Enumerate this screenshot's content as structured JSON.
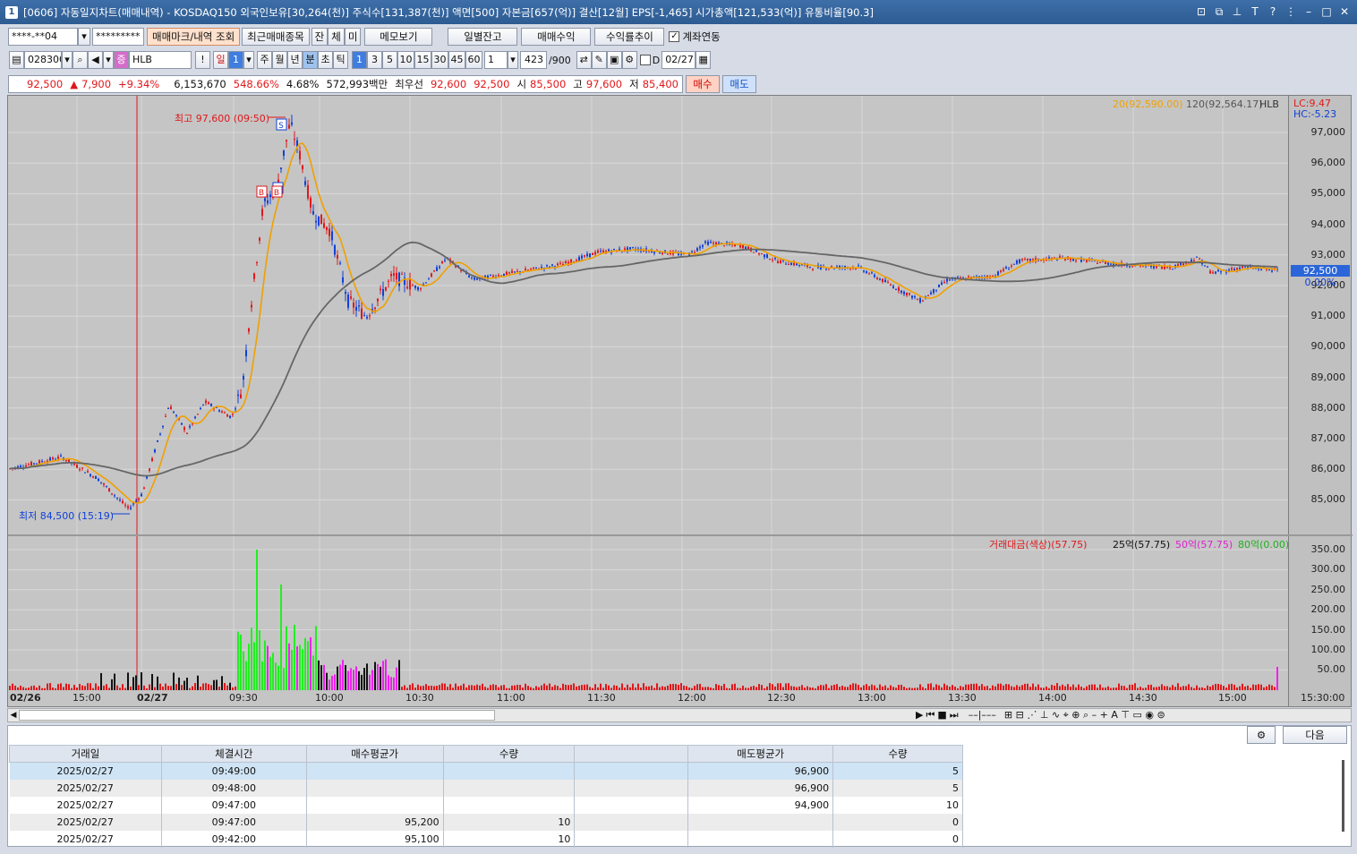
{
  "window": {
    "number": "1",
    "title": "[0606] 자동일지차트(매매내역) - KOSDAQ150 외국인보유[30,264(천)] 주식수[131,387(천)] 액면[500] 자본금[657(억)] 결산[12월] EPS[-1,465] 시가총액[121,533(억)] 유통비율[90.3]"
  },
  "toolbar1": {
    "account": "****-**04",
    "password": "*********",
    "btn_trade_marks": "매매마크/내역 조회",
    "btn_recent_items": "최근매매종목",
    "btn_jan": "잔",
    "btn_che": "체",
    "btn_mi": "미",
    "btn_memo": "메모보기",
    "btn_daily_balance": "일별잔고",
    "btn_trade_profit": "매매수익",
    "btn_profit_trend": "수익률추이",
    "account_link_label": "계좌연동"
  },
  "toolbar2": {
    "code": "028300",
    "stock_badge": "증",
    "stock_name": "HLB",
    "period_day": "일",
    "period_value": "1",
    "period_week": "주",
    "period_month": "월",
    "period_year": "년",
    "period_minute": "분",
    "period_sec": "초",
    "period_tick": "틱",
    "intervals": [
      "1",
      "3",
      "5",
      "10",
      "15",
      "30",
      "45",
      "60"
    ],
    "custom_interval": "1",
    "count": "423",
    "count_max": "/900",
    "d_label": "D",
    "date": "02/27"
  },
  "infobar": {
    "price": "92,500",
    "change_arrow": "▲",
    "change": "7,900",
    "change_pct": "+9.34%",
    "volume": "6,153,670",
    "vol_ratio": "548.66%",
    "turnover": "4.68%",
    "amount": "572,993백만",
    "best_bid_label": "최우선",
    "best_ask": "92,600",
    "best_bid": "92,500",
    "open_label": "시",
    "open": "85,500",
    "high_label": "고",
    "high": "97,600",
    "low_label": "저",
    "low": "85,400",
    "buy_btn": "매수",
    "sell_btn": "매도"
  },
  "chart_data": {
    "type": "line",
    "legend": {
      "ma20": "20(92,590.00)",
      "ma120": "120(92,564.17)",
      "stock": "HLB",
      "lc": "LC:9.47",
      "hc": "HC:-5.23"
    },
    "price_ticks": [
      "97,000",
      "96,000",
      "95,000",
      "94,000",
      "93,000",
      "92,000",
      "91,000",
      "90,000",
      "89,000",
      "88,000",
      "87,000",
      "86,000",
      "85,000"
    ],
    "current_price_tag": "92,500",
    "current_pct_tag": "0.00%",
    "high_annotation": "최고 97,600 (09:50)",
    "low_annotation": "최저 84,500 (15:19)",
    "marks": [
      "S",
      "B",
      "S",
      "B"
    ],
    "volume_legend": {
      "amount": "거래대금(색상)(57.75)",
      "ma25": "25억(57.75)",
      "ma50": "50억(57.75)",
      "ma80": "80억(0.00)"
    },
    "volume_ticks": [
      "350.00",
      "300.00",
      "250.00",
      "200.00",
      "150.00",
      "100.00",
      "50.00"
    ],
    "time_labels": [
      "02/26",
      "15:00",
      "02/27",
      "09:30",
      "10:00",
      "10:30",
      "11:00",
      "11:30",
      "12:00",
      "12:30",
      "13:00",
      "13:30",
      "14:00",
      "14:30",
      "15:00",
      "15:30:00"
    ],
    "ylim": [
      84300,
      97900
    ],
    "ma20_color": "#f0a000",
    "ma120_color": "#666666",
    "up_color": "#e0181b",
    "down_color": "#1040d8"
  },
  "grid_panel": {
    "next_button": "다음",
    "columns": [
      "거래일",
      "체결시간",
      "매수평균가",
      "수량",
      "",
      "매도평균가",
      "수량"
    ],
    "rows": [
      [
        "2025/02/27",
        "09:49:00",
        "",
        "",
        "",
        "96,900",
        "5"
      ],
      [
        "2025/02/27",
        "09:48:00",
        "",
        "",
        "",
        "96,900",
        "5"
      ],
      [
        "2025/02/27",
        "09:47:00",
        "",
        "",
        "",
        "94,900",
        "10"
      ],
      [
        "2025/02/27",
        "09:47:00",
        "95,200",
        "10",
        "",
        "",
        "0"
      ],
      [
        "2025/02/27",
        "09:42:00",
        "95,100",
        "10",
        "",
        "",
        "0"
      ]
    ]
  }
}
